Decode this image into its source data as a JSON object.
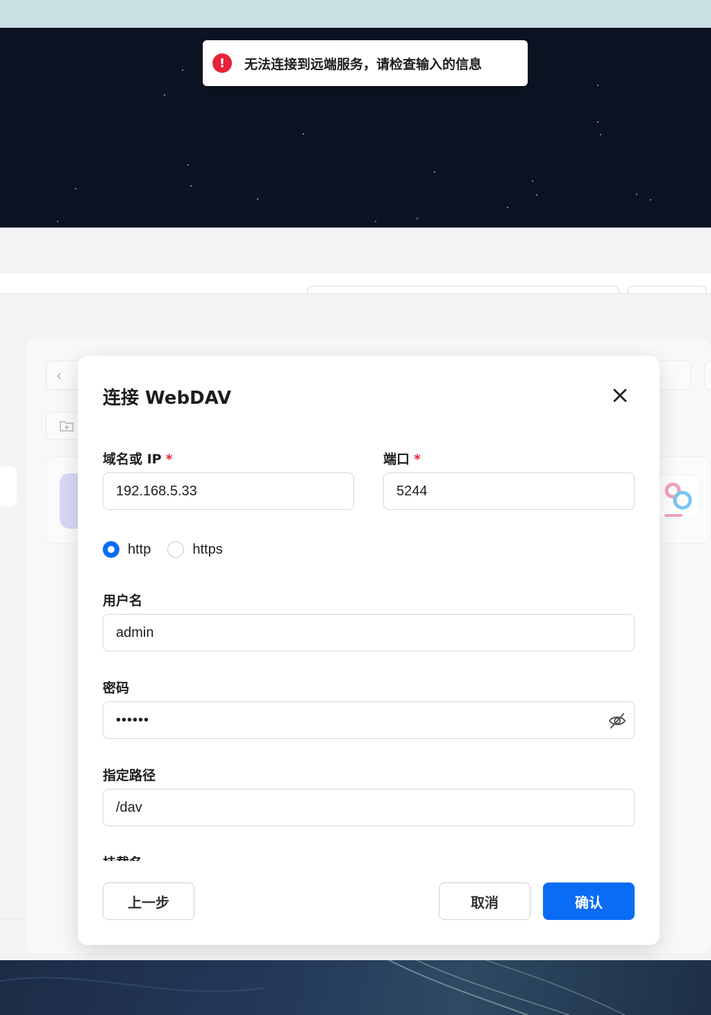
{
  "toast": {
    "icon": "error-icon",
    "message": "无法连接到远端服务，请检查输入的信息",
    "color": "#e5223a"
  },
  "dialog": {
    "title": "连接 WebDAV",
    "close_icon": "close-icon",
    "fields": {
      "host": {
        "label": "域名或 IP",
        "required_mark": "*",
        "value": "192.168.5.33"
      },
      "port": {
        "label": "端口",
        "required_mark": "*",
        "value": "5244"
      },
      "username": {
        "label": "用户名",
        "value": "admin"
      },
      "password": {
        "label": "密码",
        "value": "••••••",
        "toggle_icon": "eye-off-icon"
      },
      "path": {
        "label": "指定路径",
        "value": "/dav"
      },
      "mount_name": {
        "label": "挂载名"
      }
    },
    "protocol": {
      "selected": "http",
      "options": [
        "http",
        "https"
      ]
    },
    "buttons": {
      "prev": "上一步",
      "cancel": "取消",
      "confirm": "确认"
    },
    "accent_color": "#0a6cf5"
  }
}
